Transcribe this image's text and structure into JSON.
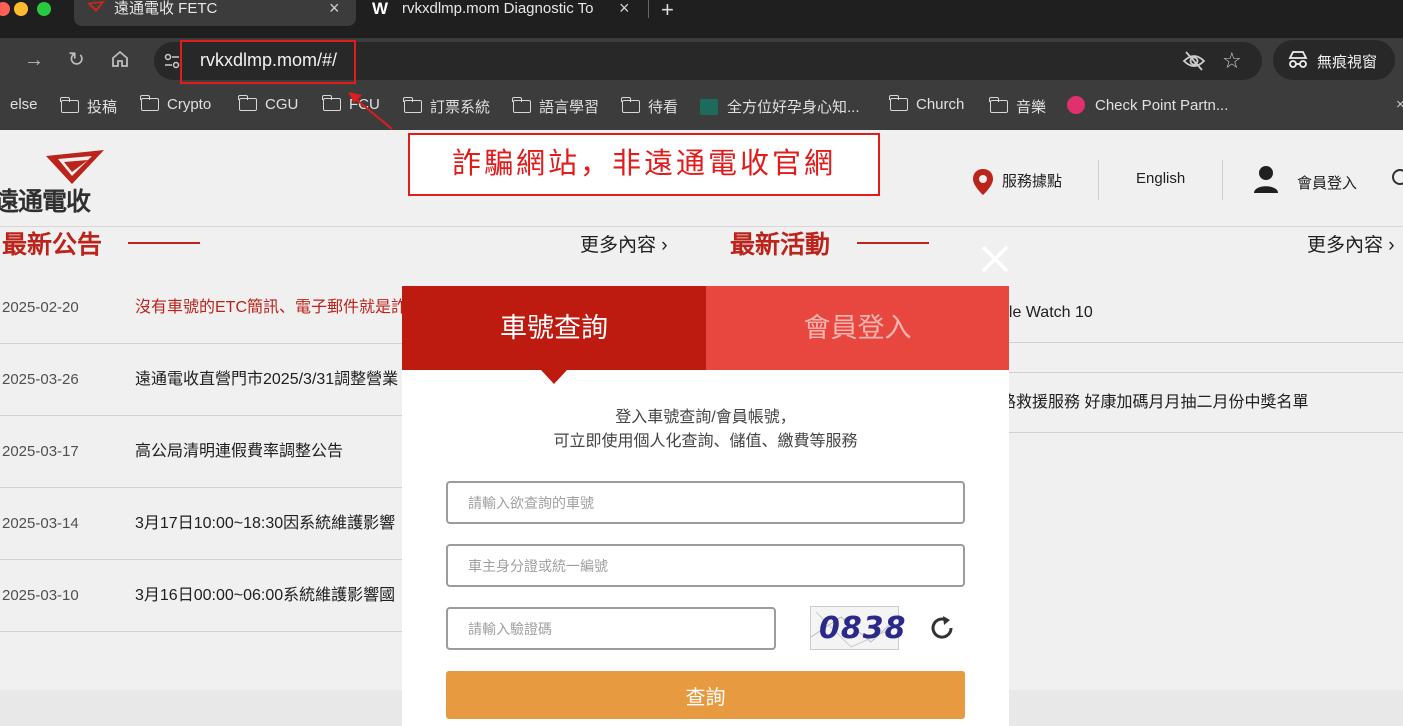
{
  "browser": {
    "tabs": [
      {
        "title": "遠通電收 FETC",
        "active": true
      },
      {
        "title": "rvkxdlmp.mom Diagnostic To",
        "active": false
      }
    ],
    "new_tab": "+",
    "url": "rvkxdlmp.mom/#/",
    "incognito_label": "無痕視窗",
    "bookmarks": [
      {
        "label": "else",
        "icon": "none"
      },
      {
        "label": "投稿",
        "icon": "folder-icon"
      },
      {
        "label": "Crypto",
        "icon": "folder-icon"
      },
      {
        "label": "CGU",
        "icon": "folder-icon"
      },
      {
        "label": "FCU",
        "icon": "folder-icon"
      },
      {
        "label": "訂票系統",
        "icon": "folder-icon"
      },
      {
        "label": "語言學習",
        "icon": "folder-icon"
      },
      {
        "label": "待看",
        "icon": "folder-icon"
      },
      {
        "label": "全方位好孕身心知...",
        "icon": "site-icon"
      },
      {
        "label": "Church",
        "icon": "folder-icon"
      },
      {
        "label": "音樂",
        "icon": "folder-icon"
      },
      {
        "label": "Check Point Partn...",
        "icon": "site-icon"
      }
    ]
  },
  "site": {
    "logo_text": "遠通電收",
    "nav": {
      "service": "服務據點",
      "language": "English",
      "login": "會員登入"
    },
    "news": {
      "title": "最新公告",
      "more": "更多內容",
      "items": [
        {
          "date": "2025-02-20",
          "text": "沒有車號的ETC簡訊、電子郵件就是詐",
          "highlight": true
        },
        {
          "date": "2025-03-26",
          "text": "遠通電收直營門市2025/3/31調整營業",
          "highlight": false
        },
        {
          "date": "2025-03-17",
          "text": "高公局清明連假費率調整公告",
          "highlight": false
        },
        {
          "date": "2025-03-14",
          "text": "3月17日10:00~18:30因系統維護影響",
          "highlight": false
        },
        {
          "date": "2025-03-10",
          "text": "3月16日00:00~06:00系統維護影響國",
          "highlight": false
        }
      ]
    },
    "activities": {
      "title": "最新活動",
      "more": "更多內容",
      "items": [
        {
          "text": "ple Watch 10"
        },
        {
          "text": "路救援服務 好康加碼月月抽二月份中獎名單"
        }
      ]
    }
  },
  "modal": {
    "tab_active": "車號查詢",
    "tab_inactive": "會員登入",
    "desc_line1": "登入車號查詢/會員帳號，",
    "desc_line2": "可立即使用個人化查詢、儲值、繳費等服務",
    "plate_placeholder": "請輸入欲查詢的車號",
    "id_placeholder": "車主身分證或統一編號",
    "captcha_placeholder": "請輸入驗證碼",
    "captcha_code": "0838",
    "submit_label": "查詢"
  },
  "annotation": {
    "warning_text": "詐騙網站，非遠通電收官網",
    "color": "#e21b1b"
  }
}
